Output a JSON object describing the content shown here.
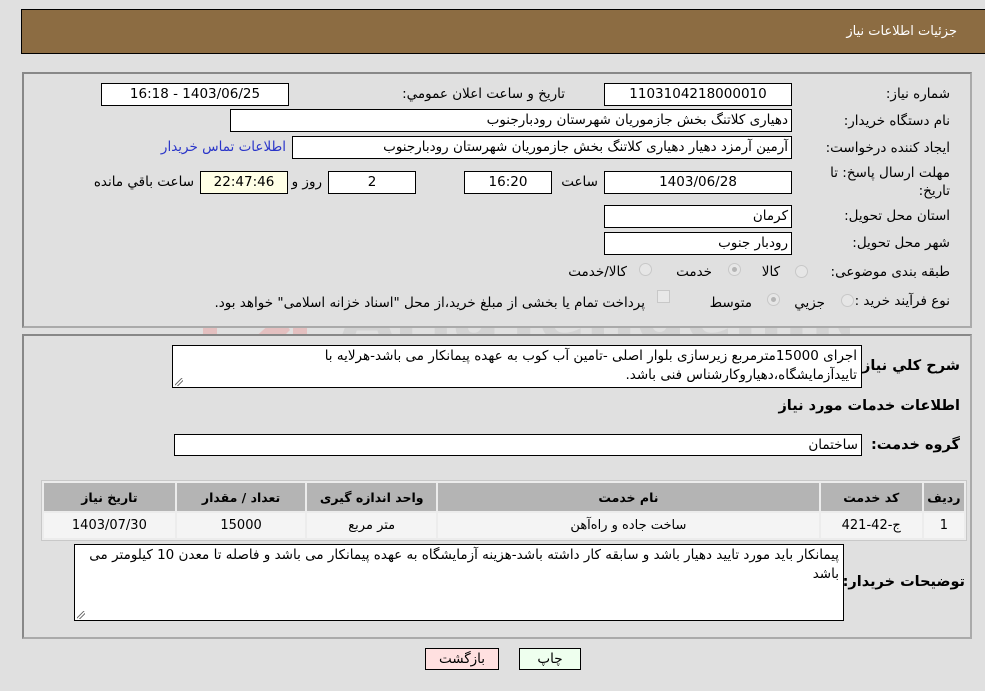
{
  "header": {
    "title": "جزئیات اطلاعات نیاز"
  },
  "fields": {
    "need_number_label": "شماره نیاز:",
    "need_number": "1103104218000010",
    "announce_label": "تاریخ و ساعت اعلان عمومي:",
    "announce_value": "1403/06/25 - 16:18",
    "buyer_org_label": "نام دستگاه خریدار:",
    "buyer_org": "دهیاری کلاتنگ بخش جازموریان شهرستان رودبارجنوب",
    "requester_label": "ایجاد کننده درخواست:",
    "requester": "آرمین آرمزد دهیار دهیاری کلاتنگ بخش جازموریان شهرستان رودبارجنوب",
    "buyer_contact_link": "اطلاعات تماس خریدار",
    "deadline_label_line1": "مهلت ارسال پاسخ: تا",
    "deadline_label_line2": "تاریخ:",
    "deadline_date": "1403/06/28",
    "time_label": "ساعت",
    "deadline_time": "16:20",
    "days_value": "2",
    "days_label": "روز و",
    "remaining_time": "22:47:46",
    "remaining_label": "ساعت باقي مانده",
    "province_label": "استان محل تحویل:",
    "province": "کرمان",
    "city_label": "شهر محل تحویل:",
    "city": "رودبار جنوب",
    "category_label": "طبقه بندی موضوعی:",
    "category_options": [
      {
        "label": "کالا",
        "checked": false
      },
      {
        "label": "خدمت",
        "checked": true
      },
      {
        "label": "کالا/خدمت",
        "checked": false
      }
    ],
    "process_label": "نوع فرآیند خرید :",
    "process_options": [
      {
        "label": "جزيي",
        "checked": false
      },
      {
        "label": "متوسط",
        "checked": true
      }
    ],
    "treasury_note": "پرداخت تمام یا بخشی از مبلغ خرید،از محل \"اسناد خزانه اسلامی\" خواهد بود."
  },
  "details": {
    "description_label": "شرح کلي نیاز:",
    "description": "اجرای 15000مترمربع زیرسازی بلوار اصلی -تامین آب کوب به عهده پیمانکار می باشد-هرلایه با تاییدآزمایشگاه،دهیاروکارشناس فنی باشد.",
    "services_heading": "اطلاعات خدمات مورد نیاز",
    "service_group_label": "گروه خدمت:",
    "service_group": "ساختمان",
    "table": {
      "headers": [
        "ردیف",
        "کد خدمت",
        "نام خدمت",
        "واحد اندازه گیری",
        "تعداد / مقدار",
        "تاریخ نیاز"
      ],
      "rows": [
        [
          "1",
          "ج-42-421",
          "ساخت جاده و راه‌آهن",
          "متر مربع",
          "15000",
          "1403/07/30"
        ]
      ]
    },
    "buyer_notes_label": "توضیحات خریدار:",
    "buyer_notes": "پیمانکار باید مورد تایید دهیار باشد و سابقه کار داشته باشد-هزینه آزمایشگاه به عهده پیمانکار می باشد و فاصله تا معدن 10 کیلومتر می باشد"
  },
  "buttons": {
    "print": "چاپ",
    "back": "بازگشت"
  },
  "colors": {
    "header_bg": "#8c6c42",
    "print_bg": "#eeffee",
    "back_bg": "#ffe0e0",
    "link": "#2a35c9"
  },
  "watermark": {
    "text": "AriaTender.neT"
  }
}
